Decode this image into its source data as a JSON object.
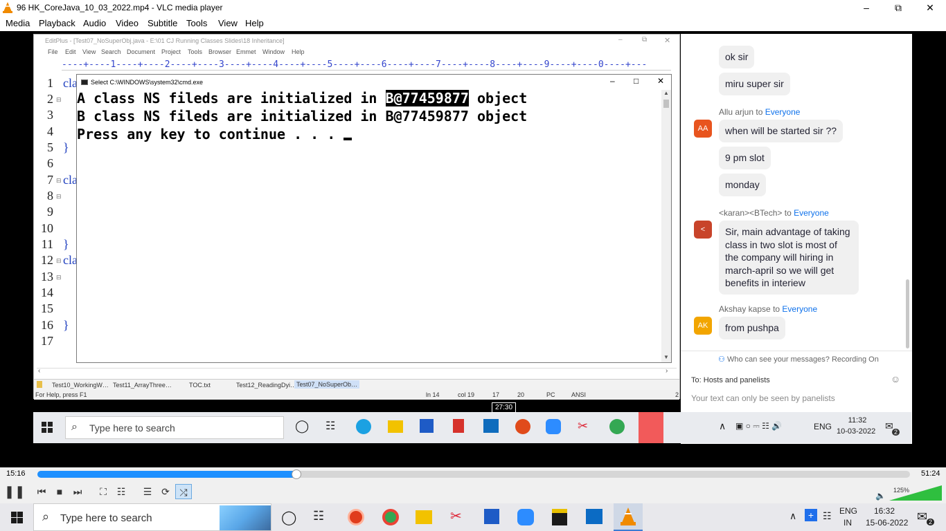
{
  "window": {
    "title": "96 HK_CoreJava_10_03_2022.mp4 - VLC media player"
  },
  "menu": [
    "Media",
    "Playback",
    "Audio",
    "Video",
    "Subtitle",
    "Tools",
    "View",
    "Help"
  ],
  "editplus": {
    "title": "EditPlus - [Test07_NoSuperObj.java - E:\\01 CJ Running Classes Slides\\18 Inheritance]",
    "menu": [
      "File",
      "Edit",
      "View",
      "Search",
      "Document",
      "Project",
      "Tools",
      "Browser",
      "Emmet",
      "Window",
      "Help"
    ],
    "ruler": "----+----1----+----2----+----3----+----4----+----5----+----6----+----7----+----8----+----9----+----0----+---",
    "line_numbers": [
      "1",
      "2",
      "3",
      "4",
      "5",
      "6",
      "7",
      "8",
      "9",
      "10",
      "11",
      "12",
      "13",
      "14",
      "15",
      "16",
      "17"
    ],
    "code_fragments": {
      "l1": "cla",
      "l5": "}",
      "l7": "cla",
      "l11": "}",
      "l12": "cla",
      "l16": "}"
    },
    "tabs": [
      "Test10_WorkingW…",
      "Test11_ArrayThree…",
      "TOC.txt",
      "Test12_ReadingDyi…",
      "Test07_NoSuperOb…"
    ],
    "status": {
      "help": "For Help, press F1",
      "ln": "ln 14",
      "col": "col 19",
      "n1": "17",
      "n2": "20",
      "pc": "PC",
      "enc": "ANSI",
      "last": "2"
    }
  },
  "cmd": {
    "title": "Select C:\\WINDOWS\\system32\\cmd.exe",
    "line1_pre": "A class NS fileds are initialized in ",
    "line1_sel": "B@77459877",
    "line1_post": " object",
    "line2": "B class NS fileds are initialized in B@77459877 object",
    "line3": "Press any key to continue . . . "
  },
  "chat": {
    "messages": [
      {
        "text": "ok sir"
      },
      {
        "text": "miru super sir"
      },
      {
        "sender": "Allu arjun",
        "to": "Everyone",
        "avatar": "AA",
        "text": "when will be started sir ??"
      },
      {
        "text": "9 pm slot"
      },
      {
        "text": "monday"
      },
      {
        "sender": "<karan><BTech>",
        "to": "Everyone",
        "avatar": "<",
        "text": "Sir, main advantage of taking class in two slot is most of the company will hiring in march-april so we will get benefits in interiew"
      },
      {
        "sender": "Akshay kapse",
        "to": "Everyone",
        "avatar": "AK",
        "text": "from pushpa"
      }
    ],
    "to_word": "to",
    "privacy": "Who can see your messages? Recording On",
    "recipient_label": "To:",
    "recipient": "Hosts and panelists",
    "input_placeholder": "Your text can only be seen by panelists"
  },
  "inner_taskbar": {
    "search": "Type here to search",
    "lang": "ENG",
    "time": "11:32",
    "date": "10-03-2022",
    "notif": "2",
    "hover_time": "27:30"
  },
  "player": {
    "elapsed": "15:16",
    "total": "51:24",
    "progress": 0.297,
    "volume_label": "125%"
  },
  "taskbar": {
    "search": "Type here to search",
    "lang": "ENG",
    "region": "IN",
    "time": "16:32",
    "date": "15-06-2022",
    "notif": "2"
  }
}
